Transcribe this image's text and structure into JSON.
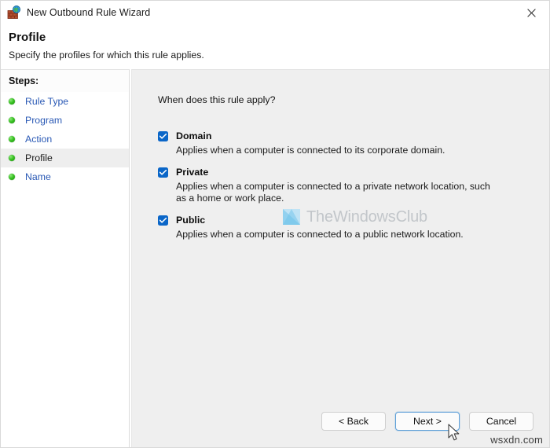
{
  "window": {
    "title": "New Outbound Rule Wizard",
    "title_icon": "firewall-globe-icon",
    "close_icon": "close-icon"
  },
  "header": {
    "title": "Profile",
    "subtitle": "Specify the profiles for which this rule applies."
  },
  "sidebar": {
    "heading": "Steps:",
    "items": [
      {
        "label": "Rule Type",
        "active": false,
        "bullet": "green-dot-icon"
      },
      {
        "label": "Program",
        "active": false,
        "bullet": "green-dot-icon"
      },
      {
        "label": "Action",
        "active": false,
        "bullet": "green-dot-icon"
      },
      {
        "label": "Profile",
        "active": true,
        "bullet": "green-dot-icon"
      },
      {
        "label": "Name",
        "active": false,
        "bullet": "green-dot-icon"
      }
    ]
  },
  "main": {
    "question": "When does this rule apply?",
    "options": [
      {
        "label": "Domain",
        "checked": true,
        "description": "Applies when a computer is connected to its corporate domain."
      },
      {
        "label": "Private",
        "checked": true,
        "description": "Applies when a computer is connected to a private network location, such as a home or work place."
      },
      {
        "label": "Public",
        "checked": true,
        "description": "Applies when a computer is connected to a public network location."
      }
    ]
  },
  "footer": {
    "back_label": "< Back",
    "next_label": "Next >",
    "cancel_label": "Cancel"
  },
  "watermark": {
    "text": "TheWindowsClub"
  },
  "attribution": {
    "text": "wsxdn.com"
  },
  "colors": {
    "checkbox_blue": "#0a66c8",
    "link_blue": "#2a59b5",
    "bullet_green": "#35c01f",
    "focus_border": "#60a0d8",
    "panel_gray": "#efefef"
  }
}
